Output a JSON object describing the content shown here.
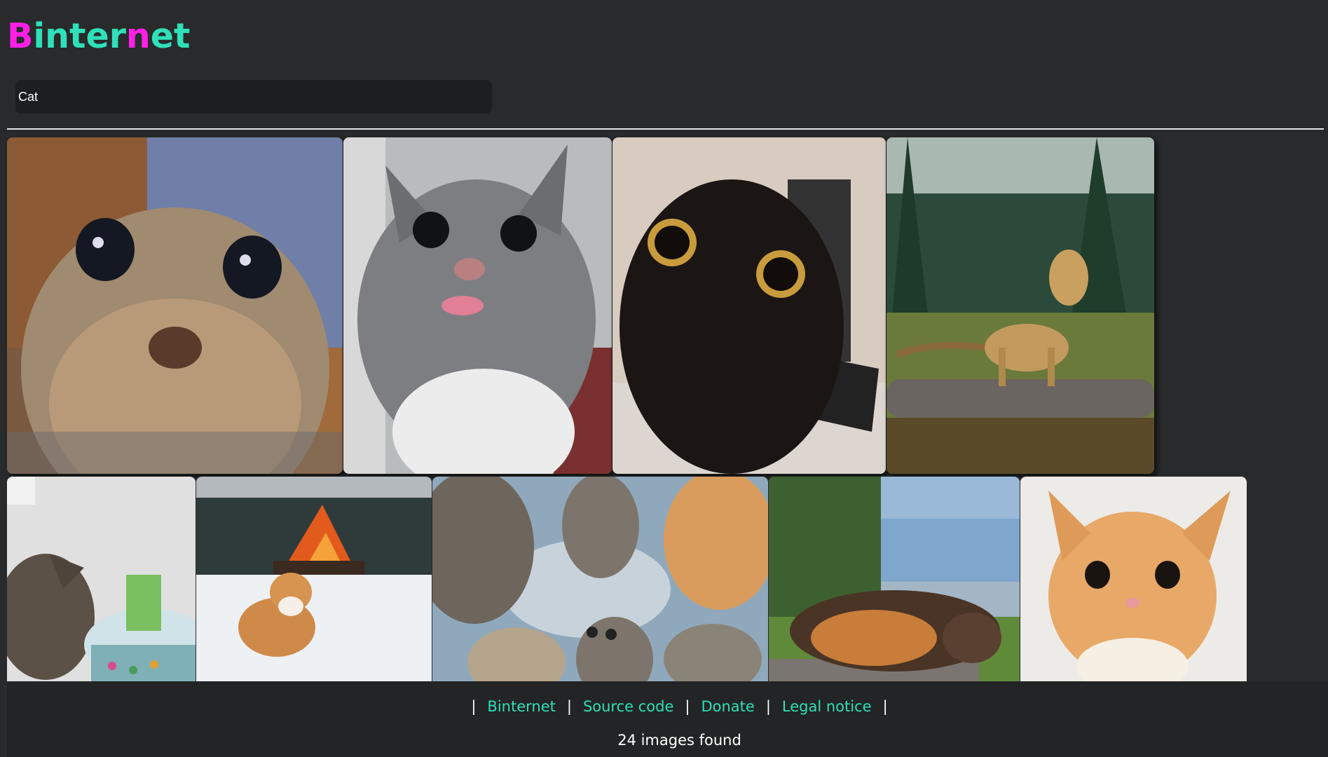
{
  "app": {
    "logo_letters": [
      {
        "char": "B",
        "color": "#ff1fe6"
      },
      {
        "char": "i",
        "color": "#2fe0b8"
      },
      {
        "char": "n",
        "color": "#2fe0b8"
      },
      {
        "char": "t",
        "color": "#2fe0b8"
      },
      {
        "char": "e",
        "color": "#2fe0b8"
      },
      {
        "char": "r",
        "color": "#2fe0b8"
      },
      {
        "char": "n",
        "color": "#ff1fe6"
      },
      {
        "char": "e",
        "color": "#2fe0b8"
      },
      {
        "char": "t",
        "color": "#2fe0b8"
      }
    ]
  },
  "search": {
    "value": "Cat"
  },
  "gallery": {
    "rows": [
      [
        {
          "name": "image-result-1",
          "subject": "wide-eyed tabby cat close-up"
        },
        {
          "name": "image-result-2",
          "subject": "grey and white cat sticking tongue out"
        },
        {
          "name": "image-result-3",
          "subject": "black cat with round eyes"
        },
        {
          "name": "image-result-4",
          "subject": "bengal cat standing on log in forest"
        }
      ],
      [
        {
          "name": "image-result-5",
          "subject": "cat looking at grass in fishbowl"
        },
        {
          "name": "image-result-6",
          "subject": "orange cat in snow with bonfire"
        },
        {
          "name": "image-result-7",
          "subject": "illustrated cats looking down at camera"
        },
        {
          "name": "image-result-8",
          "subject": "calico cat sleeping by lake"
        },
        {
          "name": "image-result-9",
          "subject": "orange kitten with big eyes"
        }
      ]
    ]
  },
  "footer": {
    "separator": "|",
    "links": [
      "Binternet",
      "Source code",
      "Donate",
      "Legal notice"
    ],
    "link_color": "#2fe0b8",
    "result_count": "24 images found"
  }
}
